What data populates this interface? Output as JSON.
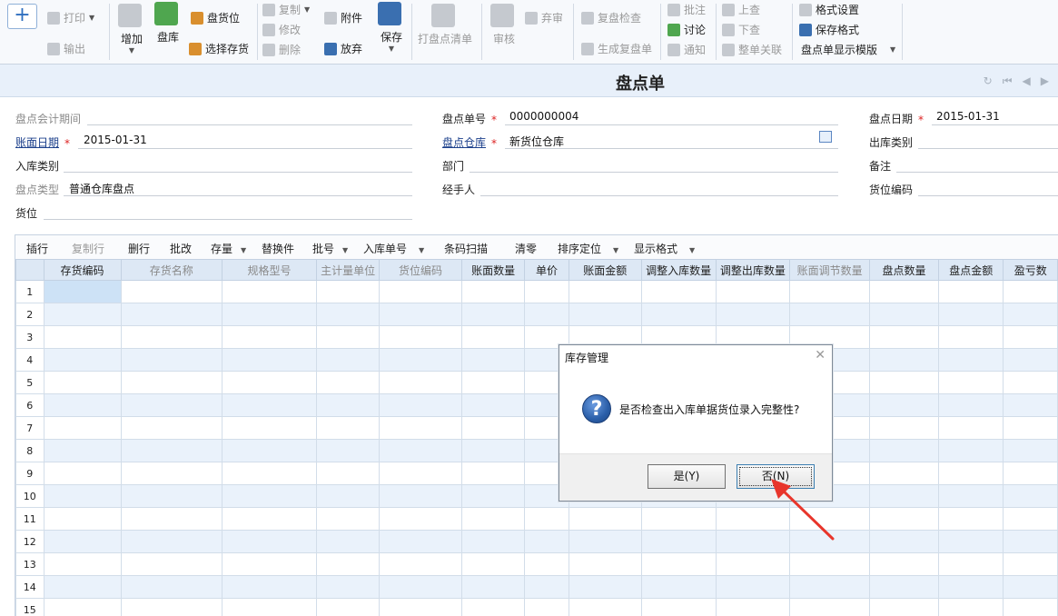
{
  "toolbar": {
    "print": "打印",
    "export": "输出",
    "add": "增加",
    "stocktake": "盘库",
    "location": "盘货位",
    "select_inventory": "选择存货",
    "copy": "复制",
    "modify": "修改",
    "delete": "删除",
    "attachment": "附件",
    "discard": "放弃",
    "save": "保存",
    "print_list": "打盘点清单",
    "audit": "审核",
    "abandon": "弃审",
    "recheck": "复盘检查",
    "gen_recheck": "生成复盘单",
    "annotate": "批注",
    "discuss": "讨论",
    "notify": "通知",
    "prev": "上查",
    "next": "下查",
    "relate": "整单关联",
    "format_settings": "格式设置",
    "save_format": "保存格式",
    "display_template": "盘点单显示模版"
  },
  "title": "盘点单",
  "header": {
    "period_label": "盘点会计期间",
    "period_value": "",
    "doc_no_label": "盘点单号",
    "doc_no_value": "0000000004",
    "date_label": "盘点日期",
    "date_value": "2015-01-31",
    "book_date_label": "账面日期",
    "book_date_value": "2015-01-31",
    "warehouse_label": "盘点仓库",
    "warehouse_value": "新货位仓库",
    "out_type_label": "出库类别",
    "out_type_value": "",
    "in_type_label": "入库类别",
    "in_type_value": "",
    "dept_label": "部门",
    "dept_value": "",
    "remark_label": "备注",
    "remark_value": "",
    "check_type_label": "盘点类型",
    "check_type_value": "普通仓库盘点",
    "handler_label": "经手人",
    "handler_value": "",
    "loc_code_label": "货位编码",
    "loc_code_value": "",
    "location_label": "货位",
    "location_value": ""
  },
  "grid_toolbar": {
    "insert_row": "插行",
    "copy_row": "复制行",
    "delete_row": "删行",
    "batch_edit": "批改",
    "stock": "存量",
    "replace": "替换件",
    "batch_no": "批号",
    "in_doc_no": "入库单号",
    "barcode": "条码扫描",
    "zero": "清零",
    "sort": "排序定位",
    "display_format": "显示格式"
  },
  "grid": {
    "columns": [
      "存货编码",
      "存货名称",
      "规格型号",
      "主计量单位",
      "货位编码",
      "账面数量",
      "单价",
      "账面金额",
      "调整入库数量",
      "调整出库数量",
      "账面调节数量",
      "盘点数量",
      "盘点金额",
      "盈亏数"
    ],
    "rows": [
      "1",
      "2",
      "3",
      "4",
      "5",
      "6",
      "7",
      "8",
      "9",
      "10",
      "11",
      "12",
      "13",
      "14",
      "15"
    ]
  },
  "dialog": {
    "title": "库存管理",
    "message": "是否检查出入库单据货位录入完整性?",
    "yes": "是(Y)",
    "no": "否(N)",
    "question_glyph": "?"
  }
}
